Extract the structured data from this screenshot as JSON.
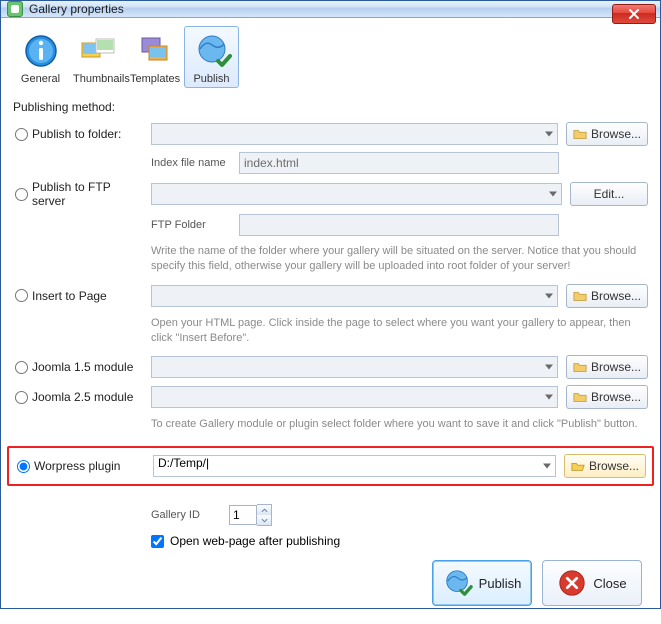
{
  "title": "Gallery properties",
  "toolbar": {
    "general": "General",
    "thumbnails": "Thumbnails",
    "templates": "Templates",
    "publish": "Publish"
  },
  "section_heading": "Publishing method:",
  "rows": {
    "folder": {
      "label": "Publish to folder:",
      "browse": "Browse...",
      "index_label": "Index file name",
      "index_value": "index.html"
    },
    "ftp": {
      "label": "Publish to FTP server",
      "edit": "Edit...",
      "folder_label": "FTP Folder",
      "hint": "Write the name of the folder where your gallery will be situated on the server. Notice that you should specify this field, otherwise your gallery will be uploaded into root folder of your server!"
    },
    "insert": {
      "label": "Insert to Page",
      "browse": "Browse...",
      "hint": "Open your HTML page. Click inside the page to select where you want your gallery to appear, then click \"Insert Before\"."
    },
    "j15": {
      "label": "Joomla 1.5 module",
      "browse": "Browse..."
    },
    "j25": {
      "label": "Joomla 2.5 module",
      "browse": "Browse...",
      "hint": "To create Gallery module or plugin select folder where you want to save it and click \"Publish\" button."
    },
    "wp": {
      "label": "Worpress plugin",
      "value": "D:/Temp/|",
      "browse": "Browse..."
    }
  },
  "gallery_id": {
    "label": "Gallery ID",
    "value": "1"
  },
  "open_after": {
    "label": "Open web-page after publishing"
  },
  "buttons": {
    "publish": "Publish",
    "close": "Close"
  }
}
